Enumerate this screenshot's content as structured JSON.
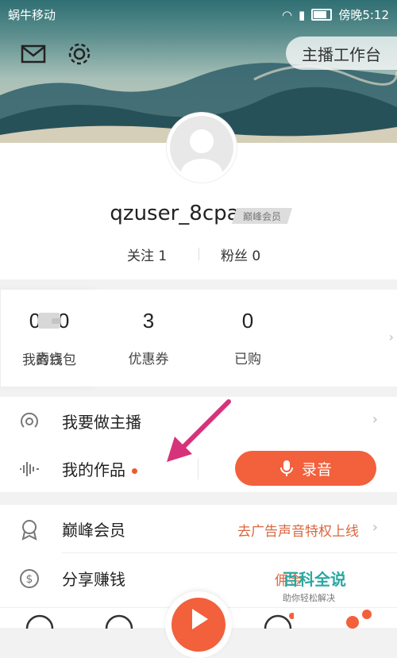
{
  "status_bar": {
    "carrier": "蜗牛移动",
    "time": "傍晚5:12"
  },
  "header": {
    "studio_label": "主播工作台"
  },
  "profile": {
    "username": "qzuser_8cpa",
    "vip_badge": "巅峰会员",
    "follow_label": "关注",
    "follow_count": "1",
    "fans_label": "粉丝",
    "fans_count": "0"
  },
  "stats": [
    {
      "value": "0.00",
      "label": "喜点"
    },
    {
      "value": "3",
      "label": "优惠券"
    },
    {
      "value": "0",
      "label": "已购"
    }
  ],
  "wallet": {
    "label": "我的钱包"
  },
  "menu": {
    "be_anchor": "我要做主播",
    "my_works": "我的作品",
    "record": "录音",
    "vip": "巅峰会员",
    "vip_hint": "去广告声音特权上线",
    "share_earn": "分享赚钱",
    "share_hint": "佣金"
  },
  "watermark": {
    "title": "百科全说",
    "subtitle": "助你轻松解决"
  },
  "colors": {
    "accent": "#f2603c",
    "hint": "#d9663f",
    "arrow": "#d6337a"
  }
}
